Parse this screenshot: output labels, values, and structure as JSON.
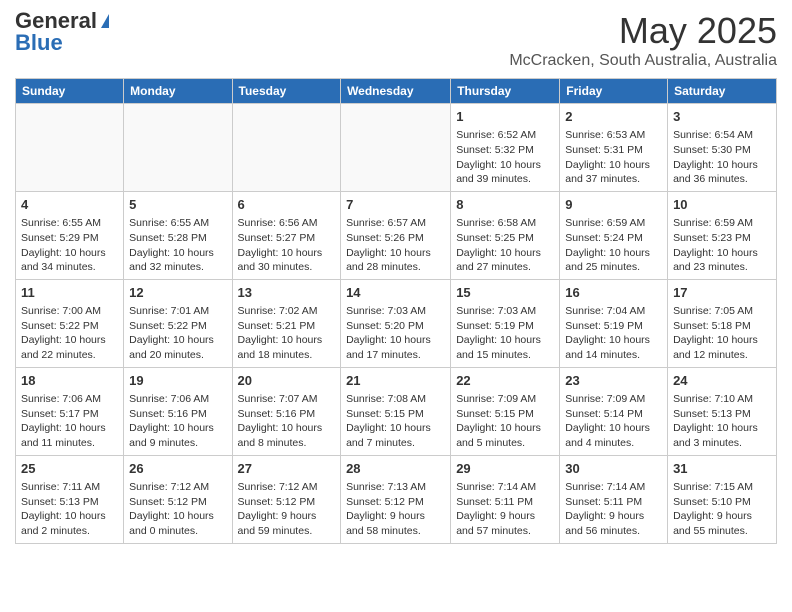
{
  "header": {
    "logo_general": "General",
    "logo_blue": "Blue",
    "month_title": "May 2025",
    "location": "McCracken, South Australia, Australia"
  },
  "weekdays": [
    "Sunday",
    "Monday",
    "Tuesday",
    "Wednesday",
    "Thursday",
    "Friday",
    "Saturday"
  ],
  "weeks": [
    [
      {
        "day": "",
        "info": ""
      },
      {
        "day": "",
        "info": ""
      },
      {
        "day": "",
        "info": ""
      },
      {
        "day": "",
        "info": ""
      },
      {
        "day": "1",
        "info": "Sunrise: 6:52 AM\nSunset: 5:32 PM\nDaylight: 10 hours and 39 minutes."
      },
      {
        "day": "2",
        "info": "Sunrise: 6:53 AM\nSunset: 5:31 PM\nDaylight: 10 hours and 37 minutes."
      },
      {
        "day": "3",
        "info": "Sunrise: 6:54 AM\nSunset: 5:30 PM\nDaylight: 10 hours and 36 minutes."
      }
    ],
    [
      {
        "day": "4",
        "info": "Sunrise: 6:55 AM\nSunset: 5:29 PM\nDaylight: 10 hours and 34 minutes."
      },
      {
        "day": "5",
        "info": "Sunrise: 6:55 AM\nSunset: 5:28 PM\nDaylight: 10 hours and 32 minutes."
      },
      {
        "day": "6",
        "info": "Sunrise: 6:56 AM\nSunset: 5:27 PM\nDaylight: 10 hours and 30 minutes."
      },
      {
        "day": "7",
        "info": "Sunrise: 6:57 AM\nSunset: 5:26 PM\nDaylight: 10 hours and 28 minutes."
      },
      {
        "day": "8",
        "info": "Sunrise: 6:58 AM\nSunset: 5:25 PM\nDaylight: 10 hours and 27 minutes."
      },
      {
        "day": "9",
        "info": "Sunrise: 6:59 AM\nSunset: 5:24 PM\nDaylight: 10 hours and 25 minutes."
      },
      {
        "day": "10",
        "info": "Sunrise: 6:59 AM\nSunset: 5:23 PM\nDaylight: 10 hours and 23 minutes."
      }
    ],
    [
      {
        "day": "11",
        "info": "Sunrise: 7:00 AM\nSunset: 5:22 PM\nDaylight: 10 hours and 22 minutes."
      },
      {
        "day": "12",
        "info": "Sunrise: 7:01 AM\nSunset: 5:22 PM\nDaylight: 10 hours and 20 minutes."
      },
      {
        "day": "13",
        "info": "Sunrise: 7:02 AM\nSunset: 5:21 PM\nDaylight: 10 hours and 18 minutes."
      },
      {
        "day": "14",
        "info": "Sunrise: 7:03 AM\nSunset: 5:20 PM\nDaylight: 10 hours and 17 minutes."
      },
      {
        "day": "15",
        "info": "Sunrise: 7:03 AM\nSunset: 5:19 PM\nDaylight: 10 hours and 15 minutes."
      },
      {
        "day": "16",
        "info": "Sunrise: 7:04 AM\nSunset: 5:19 PM\nDaylight: 10 hours and 14 minutes."
      },
      {
        "day": "17",
        "info": "Sunrise: 7:05 AM\nSunset: 5:18 PM\nDaylight: 10 hours and 12 minutes."
      }
    ],
    [
      {
        "day": "18",
        "info": "Sunrise: 7:06 AM\nSunset: 5:17 PM\nDaylight: 10 hours and 11 minutes."
      },
      {
        "day": "19",
        "info": "Sunrise: 7:06 AM\nSunset: 5:16 PM\nDaylight: 10 hours and 9 minutes."
      },
      {
        "day": "20",
        "info": "Sunrise: 7:07 AM\nSunset: 5:16 PM\nDaylight: 10 hours and 8 minutes."
      },
      {
        "day": "21",
        "info": "Sunrise: 7:08 AM\nSunset: 5:15 PM\nDaylight: 10 hours and 7 minutes."
      },
      {
        "day": "22",
        "info": "Sunrise: 7:09 AM\nSunset: 5:15 PM\nDaylight: 10 hours and 5 minutes."
      },
      {
        "day": "23",
        "info": "Sunrise: 7:09 AM\nSunset: 5:14 PM\nDaylight: 10 hours and 4 minutes."
      },
      {
        "day": "24",
        "info": "Sunrise: 7:10 AM\nSunset: 5:13 PM\nDaylight: 10 hours and 3 minutes."
      }
    ],
    [
      {
        "day": "25",
        "info": "Sunrise: 7:11 AM\nSunset: 5:13 PM\nDaylight: 10 hours and 2 minutes."
      },
      {
        "day": "26",
        "info": "Sunrise: 7:12 AM\nSunset: 5:12 PM\nDaylight: 10 hours and 0 minutes."
      },
      {
        "day": "27",
        "info": "Sunrise: 7:12 AM\nSunset: 5:12 PM\nDaylight: 9 hours and 59 minutes."
      },
      {
        "day": "28",
        "info": "Sunrise: 7:13 AM\nSunset: 5:12 PM\nDaylight: 9 hours and 58 minutes."
      },
      {
        "day": "29",
        "info": "Sunrise: 7:14 AM\nSunset: 5:11 PM\nDaylight: 9 hours and 57 minutes."
      },
      {
        "day": "30",
        "info": "Sunrise: 7:14 AM\nSunset: 5:11 PM\nDaylight: 9 hours and 56 minutes."
      },
      {
        "day": "31",
        "info": "Sunrise: 7:15 AM\nSunset: 5:10 PM\nDaylight: 9 hours and 55 minutes."
      }
    ]
  ]
}
